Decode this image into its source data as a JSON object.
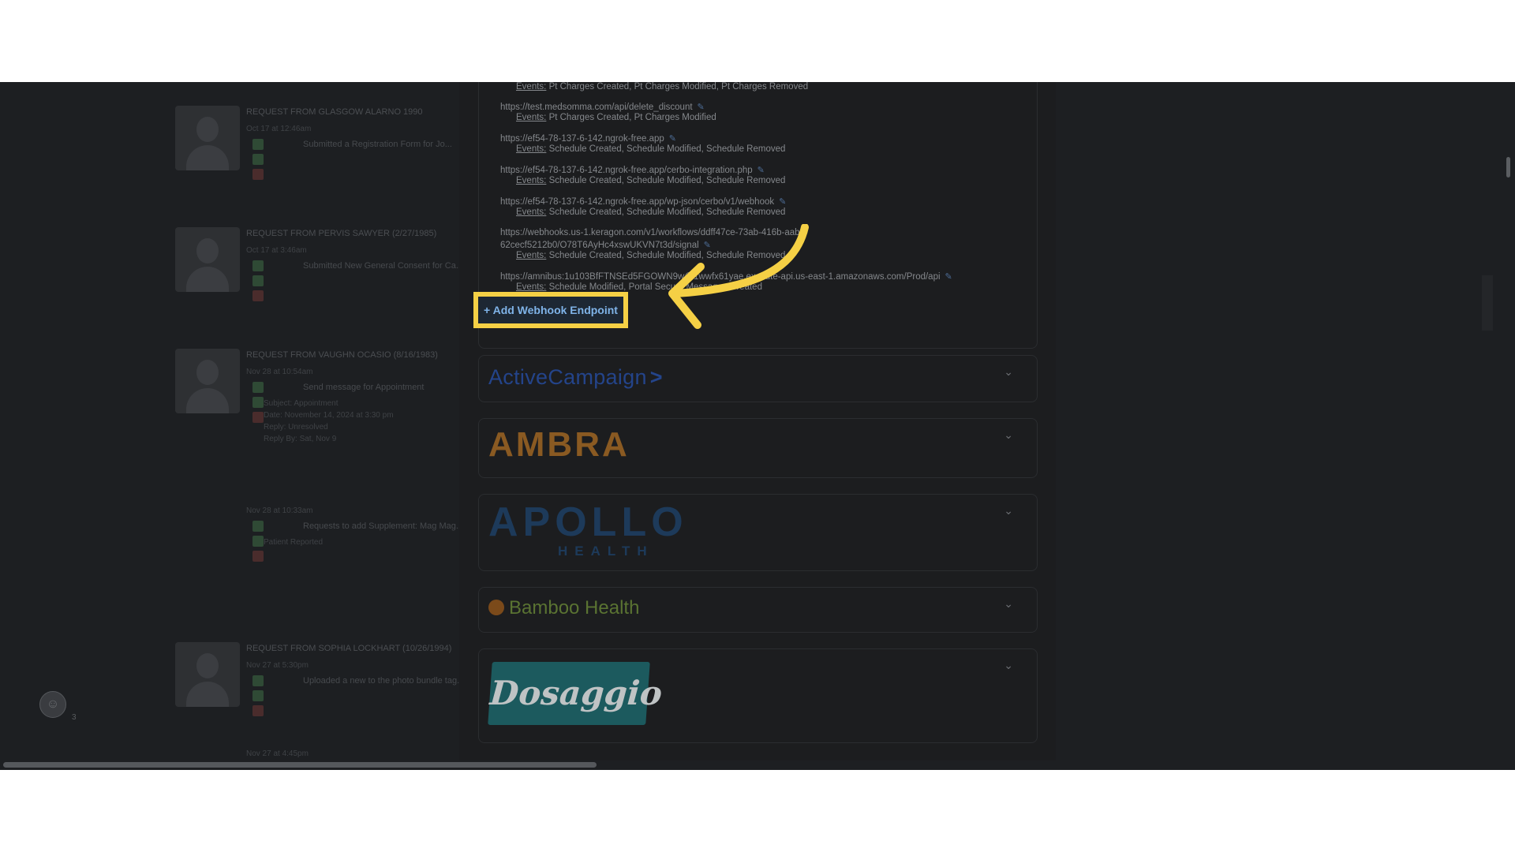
{
  "feed": {
    "items": [
      {
        "title": "REQUEST FROM GLASGOW ALARNO 1990",
        "time": "Oct 17 at 12:46am",
        "text": "Submitted a Registration Form for Jo..."
      },
      {
        "title": "REQUEST FROM PERVIS SAWYER (2/27/1985)",
        "time": "Oct 17 at 3:46am",
        "text": "Submitted New General Consent for Ca..."
      },
      {
        "title": "REQUEST FROM VAUGHN OCASIO (8/16/1983)",
        "time": "Nov 28 at 10:54am",
        "text": "Send message for Appointment",
        "sub": [
          "Subject: Appointment",
          "Date: November 14, 2024 at 3:30 pm",
          "Reply: Unresolved",
          "Reply By: Sat, Nov 9"
        ]
      },
      {
        "title": "",
        "time": "Nov 28 at 10:33am",
        "text": "Requests to add Supplement: Mag Mag...",
        "sub": [
          "Patient Reported"
        ]
      },
      {
        "title": "REQUEST FROM SOPHIA LOCKHART (10/26/1994)",
        "time": "Nov 27 at 5:30pm",
        "text": "Uploaded a new to the photo bundle tag..."
      },
      {
        "title": "",
        "time": "Nov 27 at 4:45pm",
        "text": ""
      }
    ],
    "badge_icon": "user-circle-icon",
    "badge_count": "3"
  },
  "webhooks": {
    "events_label": "Events:",
    "items": [
      {
        "url": "",
        "events": "Pt Charges Created, Pt Charges Modified, Pt Charges Removed"
      },
      {
        "url": "https://test.medsomma.com/api/delete_discount",
        "events": "Pt Charges Created, Pt Charges Modified"
      },
      {
        "url": "https://ef54-78-137-6-142.ngrok-free.app",
        "events": "Schedule Created, Schedule Modified, Schedule Removed"
      },
      {
        "url": "https://ef54-78-137-6-142.ngrok-free.app/cerbo-integration.php",
        "events": "Schedule Created, Schedule Modified, Schedule Removed"
      },
      {
        "url": "https://ef54-78-137-6-142.ngrok-free.app/wp-json/cerbo/v1/webhook",
        "events": "Schedule Created, Schedule Modified, Schedule Removed"
      },
      {
        "url": "https://webhooks.us-1.keragon.com/v1/workflows/ddff47ce-73ab-416b-aab2-",
        "url2": "62cecf5212b0/O78T6AyHc4xswUKVN7t3d/signal",
        "events": "Schedule Created, Schedule Modified, Schedule Removed"
      },
      {
        "url": "https://amnibus:1u103BfFTNSEd5FGOWN9w@1wwfx61yae.execute-api.us-east-1.amazonaws.com/Prod/api",
        "events": "Schedule Modified, Portal Secure Messages Created"
      }
    ],
    "edit_icon": "pencil-icon",
    "add_button": "+ Add Webhook Endpoint"
  },
  "integrations": [
    {
      "logo": "ActiveCampaign",
      "logo_mark": ">",
      "color": "#24448a"
    },
    {
      "logo": "AMBRA",
      "color": "#8a5a22"
    },
    {
      "logo": "APOLLO",
      "sub": "HEALTH",
      "color": "#1d3a5a"
    },
    {
      "logo": "Bamboo Health",
      "color": "#5a7332"
    },
    {
      "logo": "Dosaggio",
      "color": "#1c5a5e"
    }
  ],
  "expand_icon": "chevron-down-icon",
  "accent": {
    "highlight": "#f5d045",
    "link": "#7fb3e8"
  }
}
